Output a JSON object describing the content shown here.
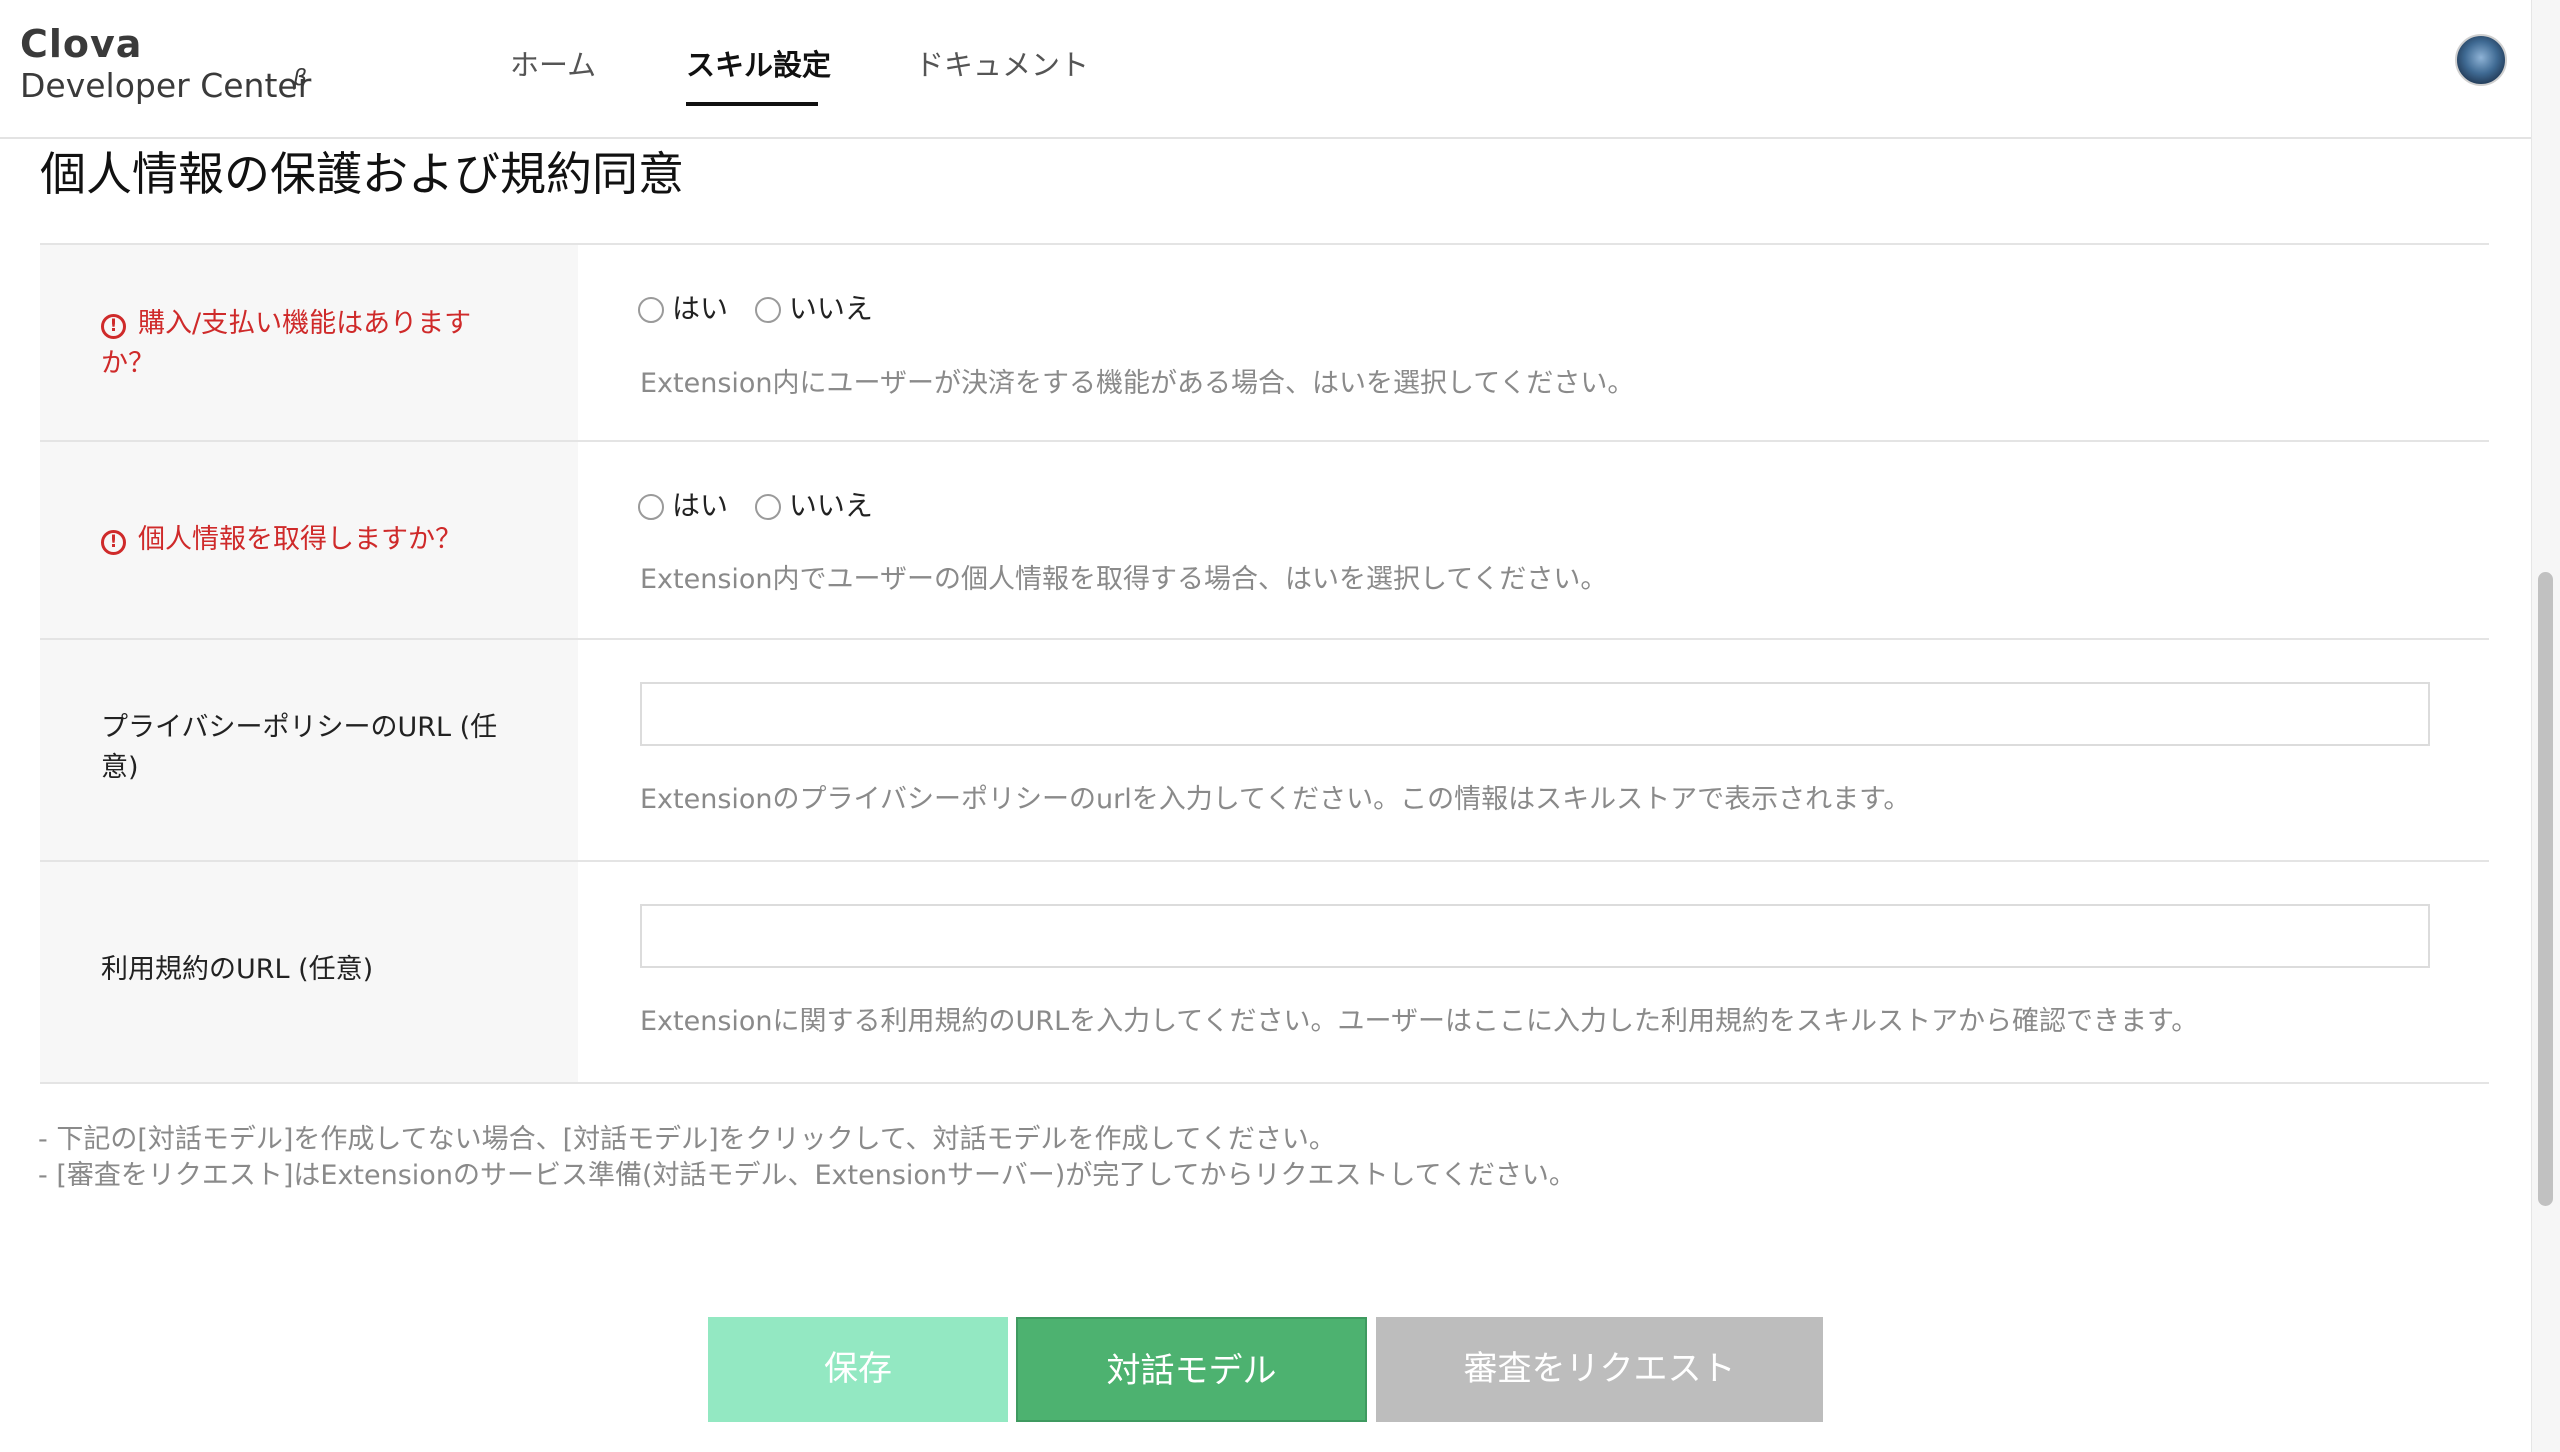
{
  "header": {
    "logo_top": "Clova",
    "logo_bottom": "Developer Center",
    "logo_beta": "β",
    "nav": {
      "home": "ホーム",
      "skill_settings": "スキル設定",
      "documents": "ドキュメント"
    },
    "active_nav": "skill_settings"
  },
  "section": {
    "title": "個人情報の保護および規約同意"
  },
  "rows": {
    "payment": {
      "label": "購入/支払い機能はありますか？",
      "required": true,
      "options": {
        "yes": "はい",
        "no": "いいえ"
      },
      "help": "Extension内にユーザーが決済をする機能がある場合、はいを選択してください。"
    },
    "personal_info": {
      "label": "個人情報を取得しますか？",
      "required": true,
      "options": {
        "yes": "はい",
        "no": "いいえ"
      },
      "help": "Extension内でユーザーの個人情報を取得する場合、はいを選択してください。"
    },
    "privacy_url": {
      "label": "プライバシーポリシーのURL (任意)",
      "value": "",
      "help": "Extensionのプライバシーポリシーのurlを入力してください。この情報はスキルストアで表示されます。"
    },
    "terms_url": {
      "label": "利用規約のURL (任意)",
      "value": "",
      "help": "Extensionに関する利用規約のURLを入力してください。ユーザーはここに入力した利用規約をスキルストアから確認できます。"
    }
  },
  "notes": {
    "line1": "- 下記の[対話モデル]を作成してない場合、[対話モデル]をクリックして、対話モデルを作成してください。",
    "line2": "- [審査をリクエスト]はExtensionのサービス準備(対話モデル、Extensionサーバー)が完了してからリクエストしてください。"
  },
  "buttons": {
    "save": "保存",
    "dialog_model": "対話モデル",
    "request_review": "審査をリクエスト"
  },
  "colors": {
    "required_red": "#cf2a2a",
    "save_green_disabled": "#93e8c2",
    "model_green": "#4db270",
    "review_gray": "#bdbdbd"
  }
}
